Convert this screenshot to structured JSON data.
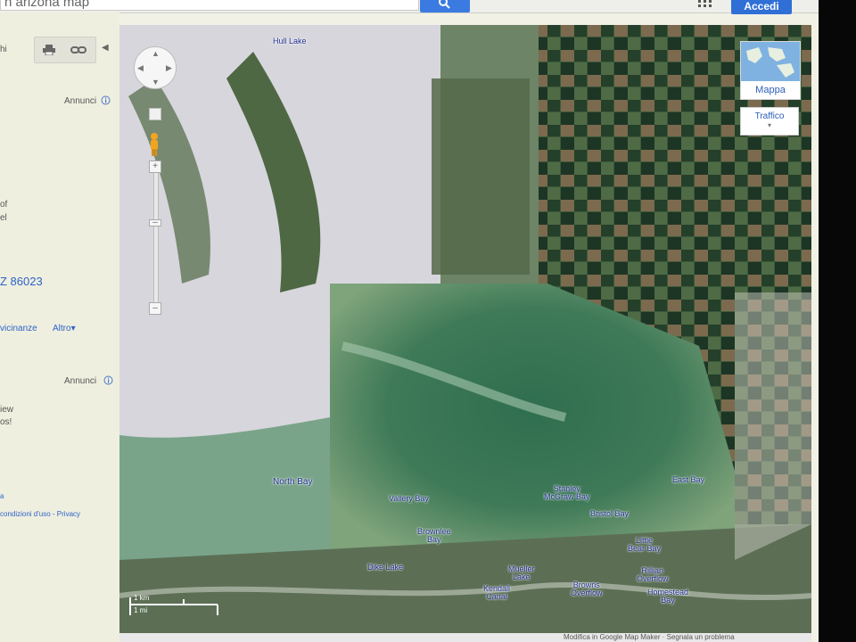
{
  "header": {
    "search_value": "n arizona map",
    "signin_label": "Accedi",
    "search_icon": "search-icon",
    "apps_icon": "apps-grid-icon",
    "accent_color": "#2f6fd6"
  },
  "leftpanel": {
    "tab_fragment": "hi",
    "print_icon": "print-icon",
    "link_icon": "link-icon",
    "ads_label_1": "Annunci",
    "ads_label_2": "Annunci",
    "info_icon": "info-icon",
    "frag_1": "of",
    "frag_2": "el",
    "zip_text": "Z 86023",
    "nearby_label": "vicinanze",
    "more_label": "Altro",
    "frag_3": "iew",
    "frag_4": "os!",
    "frag_5": "a",
    "terms_text": "condizioni d'uso - Privacy"
  },
  "map": {
    "labels": {
      "hull_lake": "Hull Lake",
      "north_bay": "North Bay",
      "vallery_bay": "Vallery Bay",
      "stanley_mcgraw_bay_1": "Stanley",
      "stanley_mcgraw_bay_2": "McGraw Bay",
      "bristol_bay": "Bristol Bay",
      "east_bay": "East Bay",
      "brownlee_bay_1": "Brownlee",
      "brownlee_bay_2": "Bay",
      "little_bear_bay_1": "Little",
      "little_bear_bay_2": "Bear Bay",
      "dike_lake": "Dike Lake",
      "mueller_lake_1": "Mueller",
      "mueller_lake_2": "Lake",
      "kendall_canal_1": "Kendall",
      "kendall_canal_2": "Canal",
      "browns_overflow_1": "Browns",
      "browns_overflow_2": "Overflow",
      "rillian_overflow_1": "Rillian",
      "rillian_overflow_2": "Overflow",
      "homestead_bay_1": "Homestead",
      "homestead_bay_2": "Bay"
    },
    "map_type_label": "Mappa",
    "traffic_label": "Traffico",
    "scale_km": "1 km",
    "scale_mi": "1 mi",
    "footer_text": "Modifica in Google Map Maker · Segnala un problema"
  }
}
